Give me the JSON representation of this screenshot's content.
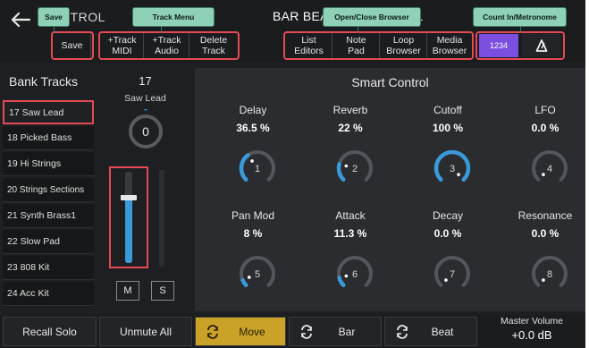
{
  "header": {
    "title": "CONTROL",
    "position": "BAR BEAT  1 1 1 1 to 33 1",
    "back_icon": "arrow-left-icon"
  },
  "callouts": {
    "save": "Save",
    "track_menu": "Track Menu",
    "browser": "Open/Close Browser",
    "count_in": "Count In/Metronome"
  },
  "toolbar": {
    "save": "Save",
    "track_midi": [
      "+Track",
      "MIDI"
    ],
    "track_audio": [
      "+Track",
      "Audio"
    ],
    "delete_track": [
      "Delete",
      "Track"
    ],
    "list_editors": [
      "List",
      "Editors"
    ],
    "note_pad": [
      "Note",
      "Pad"
    ],
    "loop_browser": [
      "Loop",
      "Browser"
    ],
    "media_browser": [
      "Media",
      "Browser"
    ],
    "count_in": "1234",
    "metronome_icon": "metronome-icon"
  },
  "bank": {
    "title": "Bank Tracks",
    "tracks": [
      "17 Saw Lead",
      "18 Picked Bass",
      "19 Hi Strings",
      "20 Strings Sections",
      "21 Synth Brass1",
      "22 Slow Pad",
      "23 808 Kit",
      "24 Acc Kit"
    ]
  },
  "channel": {
    "number": "17",
    "name": "Saw Lead",
    "knob_value": "0",
    "mute": "M",
    "solo": "S",
    "fader_level": 0.72
  },
  "smart_control": {
    "title": "Smart Control",
    "knobs": [
      {
        "label": "Delay",
        "value": "36.5 %",
        "index": "1",
        "level": 0.365
      },
      {
        "label": "Reverb",
        "value": "22 %",
        "index": "2",
        "level": 0.22
      },
      {
        "label": "Cutoff",
        "value": "100 %",
        "index": "3",
        "level": 1.0
      },
      {
        "label": "LFO",
        "value": "0.0 %",
        "index": "4",
        "level": 0.0
      },
      {
        "label": "Pan Mod",
        "value": "8 %",
        "index": "5",
        "level": 0.08
      },
      {
        "label": "Attack",
        "value": "11.3 %",
        "index": "6",
        "level": 0.113
      },
      {
        "label": "Decay",
        "value": "0.0 %",
        "index": "7",
        "level": 0.0
      },
      {
        "label": "Resonance",
        "value": "0.0 %",
        "index": "8",
        "level": 0.0
      }
    ]
  },
  "bottom": {
    "recall_solo": "Recall Solo",
    "unmute_all": "Unmute All",
    "move": "Move",
    "bar": "Bar",
    "beat": "Beat",
    "master_label": "Master Volume",
    "master_value": "+0.0 dB"
  },
  "colors": {
    "accent_blue": "#3a9ad9",
    "move_yellow": "#c9a227",
    "highlight_red": "#e34a53",
    "callout_green": "#8fd1b6",
    "count_purple": "#7b4fe0"
  }
}
